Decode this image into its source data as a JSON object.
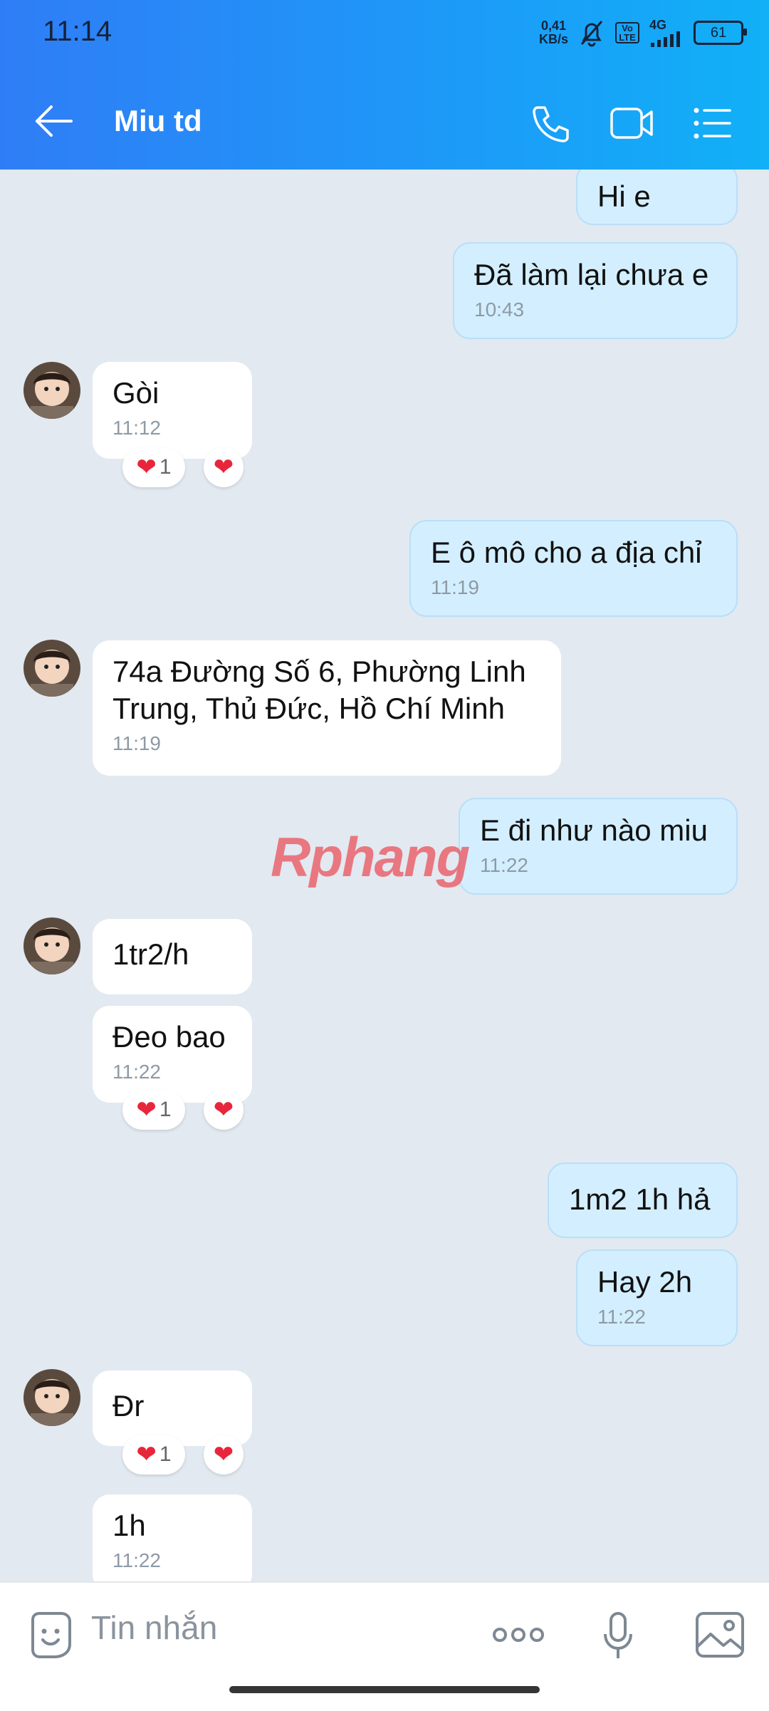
{
  "status": {
    "time": "11:14",
    "speed_top": "0,41",
    "speed_bottom": "KB/s",
    "volte": "Vo LTE",
    "network": "4G",
    "battery": "61"
  },
  "header": {
    "title": "Miu td"
  },
  "messages": [
    {
      "text": "Hi e",
      "time": ""
    },
    {
      "text": "Đã làm lại chưa e",
      "time": "10:43"
    },
    {
      "text": "Gòi",
      "time": "11:12",
      "reaction_count": "1"
    },
    {
      "text": "E ô mô cho a địa chỉ",
      "time": "11:19"
    },
    {
      "text": "74a Đường Số 6, Phường Linh Trung, Thủ Đức, Hồ Chí Minh",
      "time": "11:19"
    },
    {
      "text": "E đi như nào miu",
      "time": "11:22"
    },
    {
      "text": "1tr2/h",
      "time": ""
    },
    {
      "text": "Đeo bao",
      "time": "11:22",
      "reaction_count": "1"
    },
    {
      "text": "1m2 1h hả",
      "time": ""
    },
    {
      "text": "Hay 2h",
      "time": "11:22"
    },
    {
      "text": "Đr",
      "time": "",
      "reaction_count": "1"
    },
    {
      "text": "1h",
      "time": "11:22"
    }
  ],
  "watermark": "Rphang",
  "composer": {
    "placeholder": "Tin nhắn"
  },
  "colors": {
    "header_start": "#2f7df6",
    "header_end": "#11b0f7",
    "outgoing_bubble": "#d3efff",
    "incoming_bubble": "#ffffff",
    "chat_background": "#e2e9f1"
  }
}
